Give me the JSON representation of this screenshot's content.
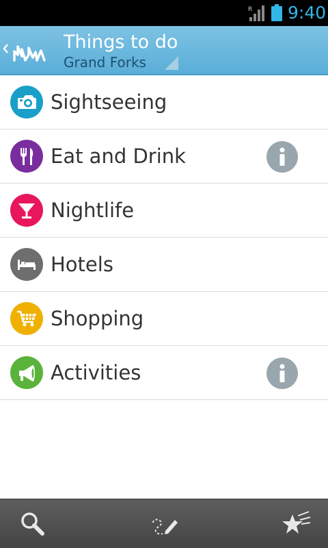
{
  "status_bar": {
    "time": "9:40",
    "roaming_indicator": "R",
    "icons": [
      "signal-icon",
      "battery-icon"
    ],
    "accent_color": "#33b5e5"
  },
  "action_bar": {
    "title": "Things to do",
    "subtitle": "Grand Forks",
    "icon": "app-logo-icon",
    "background_color": "#69b7de"
  },
  "categories": [
    {
      "label": "Sightseeing",
      "icon": "camera-icon",
      "color": "#1aa0c8",
      "info": false
    },
    {
      "label": "Eat and Drink",
      "icon": "fork-knife-icon",
      "color": "#7a2e9e",
      "info": true
    },
    {
      "label": "Nightlife",
      "icon": "cocktail-icon",
      "color": "#e8175d",
      "info": false
    },
    {
      "label": "Hotels",
      "icon": "bed-icon",
      "color": "#6e6e6e",
      "info": false
    },
    {
      "label": "Shopping",
      "icon": "shopping-cart-icon",
      "color": "#f0b000",
      "info": false
    },
    {
      "label": "Activities",
      "icon": "megaphone-icon",
      "color": "#5ab33b",
      "info": true
    }
  ],
  "bottom_bar": {
    "buttons": [
      "search-icon",
      "draw-route-icon",
      "favorites-star-icon"
    ]
  }
}
